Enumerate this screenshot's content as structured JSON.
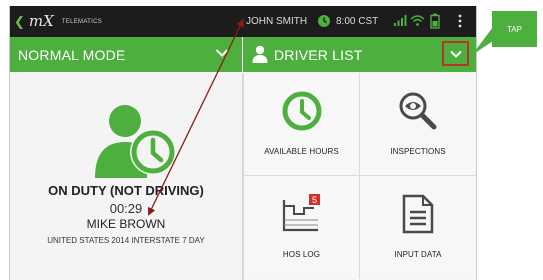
{
  "status_bar": {
    "logo_text": "mX",
    "logo_subtext": "TELEMATICS",
    "user_name": "JOHN SMITH",
    "time": "8:00 CST"
  },
  "mode_bar": {
    "label": "NORMAL MODE"
  },
  "driver_bar": {
    "label": "DRIVER LIST"
  },
  "driver_status": {
    "duty_status": "ON DUTY (NOT DRIVING)",
    "duration": "00:29",
    "driver_name": "MIKE BROWN",
    "ruleset": "UNITED STATES 2014 INTERSTATE 7 DAY"
  },
  "tiles": [
    {
      "label": "AVAILABLE HOURS",
      "icon": "clock-icon"
    },
    {
      "label": "INSPECTIONS",
      "icon": "magnifier-icon"
    },
    {
      "label": "HOS LOG",
      "icon": "hos-log-icon",
      "badge": "5"
    },
    {
      "label": "INPUT DATA",
      "icon": "document-icon"
    }
  ],
  "callout": {
    "label": "TAP"
  },
  "colors": {
    "accent_green": "#4caf3e",
    "status_bar": "#1c1c1c",
    "annotation_red": "#b8352a"
  }
}
